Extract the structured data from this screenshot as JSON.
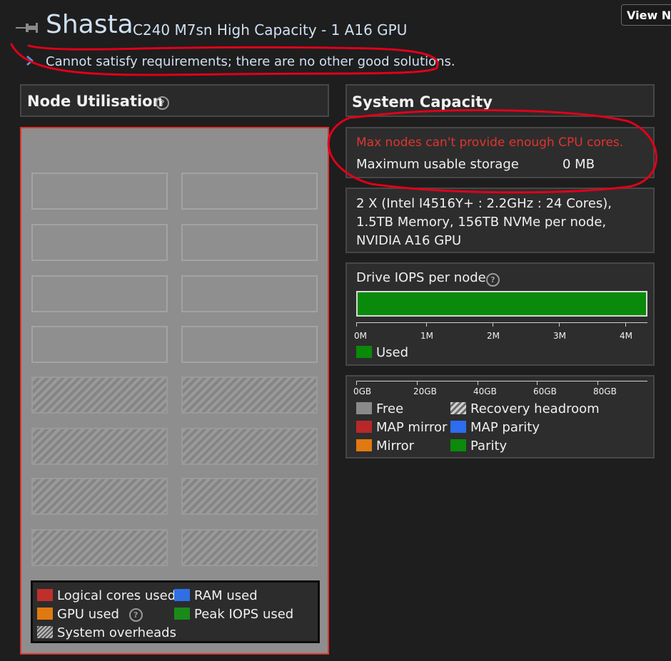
{
  "header": {
    "title": "Shasta",
    "subtitle": "C240 M7sn High Capacity - 1 A16 GPU",
    "message": "Cannot satisfy requirements; there are no other good solutions.",
    "view_button": "View No"
  },
  "node_utilisation": {
    "heading": "Node Utilisation",
    "legend": [
      {
        "label": "Logical cores used",
        "color": "#c0302b"
      },
      {
        "label": "RAM used",
        "color": "#2f6fe6"
      },
      {
        "label": "GPU used",
        "color": "#e07a10"
      },
      {
        "label": "Peak IOPS used",
        "color": "#1a8a1a"
      },
      {
        "label": "System overheads",
        "color": "hatch"
      }
    ]
  },
  "system_capacity": {
    "heading": "System Capacity",
    "error": "Max nodes can't provide enough CPU cores.",
    "storage_label": "Maximum usable storage",
    "storage_value": "0 MB",
    "node_spec": "2 X (Intel I4516Y+ : 2.2GHz : 24 Cores), 1.5TB Memory, 156TB NVMe per node, NVIDIA A16 GPU",
    "iops": {
      "label": "Drive IOPS per node",
      "ticks": [
        "0M",
        "1M",
        "2M",
        "3M",
        "4M"
      ],
      "used_label": "Used",
      "used_color": "#0a8a0a"
    },
    "storage_chart": {
      "ticks": [
        "0GB",
        "20GB",
        "40GB",
        "60GB",
        "80GB"
      ],
      "legend": [
        {
          "label": "Free",
          "color": "#8a8a8a"
        },
        {
          "label": "Recovery headroom",
          "color": "hatch"
        },
        {
          "label": "MAP mirror",
          "color": "#b8282a"
        },
        {
          "label": "MAP parity",
          "color": "#2e6cf0"
        },
        {
          "label": "Mirror",
          "color": "#e07a10"
        },
        {
          "label": "Parity",
          "color": "#0c8a0c"
        }
      ]
    }
  },
  "colors": {
    "accent_text": "#cfe0f2",
    "error": "#e0342f",
    "annotation": "#e0001a"
  }
}
